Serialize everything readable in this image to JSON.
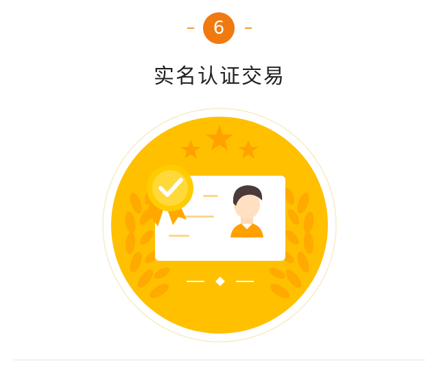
{
  "step": {
    "number": "6"
  },
  "title": "实名认证交易",
  "colors": {
    "accent_orange": "#f07a10",
    "badge_gold": "#ffc000",
    "card_white": "#ffffff",
    "text_dark": "#222222"
  },
  "icons": {
    "illustration": "verified-id-card-badge-icon"
  }
}
